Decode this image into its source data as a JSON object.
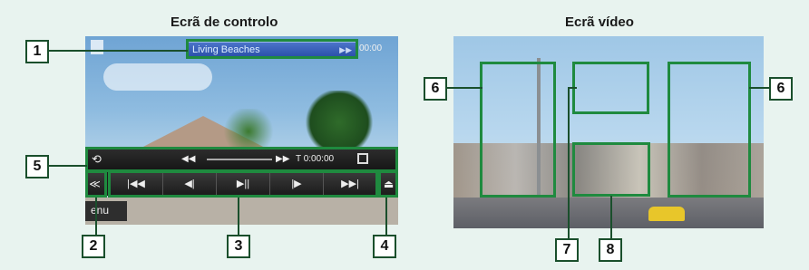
{
  "titles": {
    "control": "Ecrã de controlo",
    "video": "Ecrã vídeo"
  },
  "control_screen": {
    "track_title": "Living Beaches",
    "time_right": "00:00",
    "seek_prev_icon": "◀◀",
    "seek_next_icon": "▶▶",
    "time_display": "T 0:00:00",
    "menu_label": "enu",
    "transport_buttons": [
      {
        "name": "prev-track",
        "glyph": "|◀◀"
      },
      {
        "name": "slow-rev",
        "glyph": "◀|"
      },
      {
        "name": "play-pause",
        "glyph": "▶||"
      },
      {
        "name": "slow-fwd",
        "glyph": "|▶"
      },
      {
        "name": "next-track",
        "glyph": "▶▶|"
      }
    ]
  },
  "callouts": [
    "1",
    "2",
    "3",
    "4",
    "5",
    "6",
    "6",
    "7",
    "8"
  ],
  "colors": {
    "highlight_green": "#1f8a3f",
    "badge_border": "#1a4f2c",
    "background": "#e8f3ef"
  }
}
